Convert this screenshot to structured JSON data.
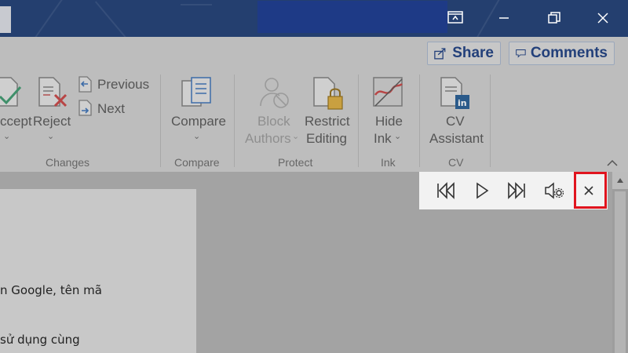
{
  "titlebar": {
    "icons": [
      "ribbon-display-icon",
      "minimize-icon",
      "restore-icon",
      "close-icon"
    ]
  },
  "ribbon": {
    "share_label": "Share",
    "comments_label": "Comments",
    "changes": {
      "accept_label": "ccept",
      "reject_label": "Reject",
      "previous_label": "Previous",
      "next_label": "Next",
      "group_label": "Changes"
    },
    "compare": {
      "compare_label": "Compare",
      "group_label": "Compare"
    },
    "protect": {
      "block_line1": "Block",
      "block_line2": "Authors",
      "restrict_line1": "Restrict",
      "restrict_line2": "Editing",
      "group_label": "Protect"
    },
    "ink": {
      "hide_line1": "Hide",
      "hide_line2": "Ink",
      "group_label": "Ink"
    },
    "cv": {
      "cv_line1": "CV",
      "cv_line2": "Assistant",
      "group_label": "CV"
    }
  },
  "document": {
    "line1": "n Google, tên mã",
    "line2": "sử dụng cùng"
  },
  "read_aloud": {
    "buttons": [
      "previous-paragraph-icon",
      "play-icon",
      "next-paragraph-icon",
      "voice-settings-icon",
      "close-icon"
    ]
  },
  "colors": {
    "titlebar": "#243f6f",
    "highlight": "#e0141e",
    "share_text": "#23407a"
  }
}
